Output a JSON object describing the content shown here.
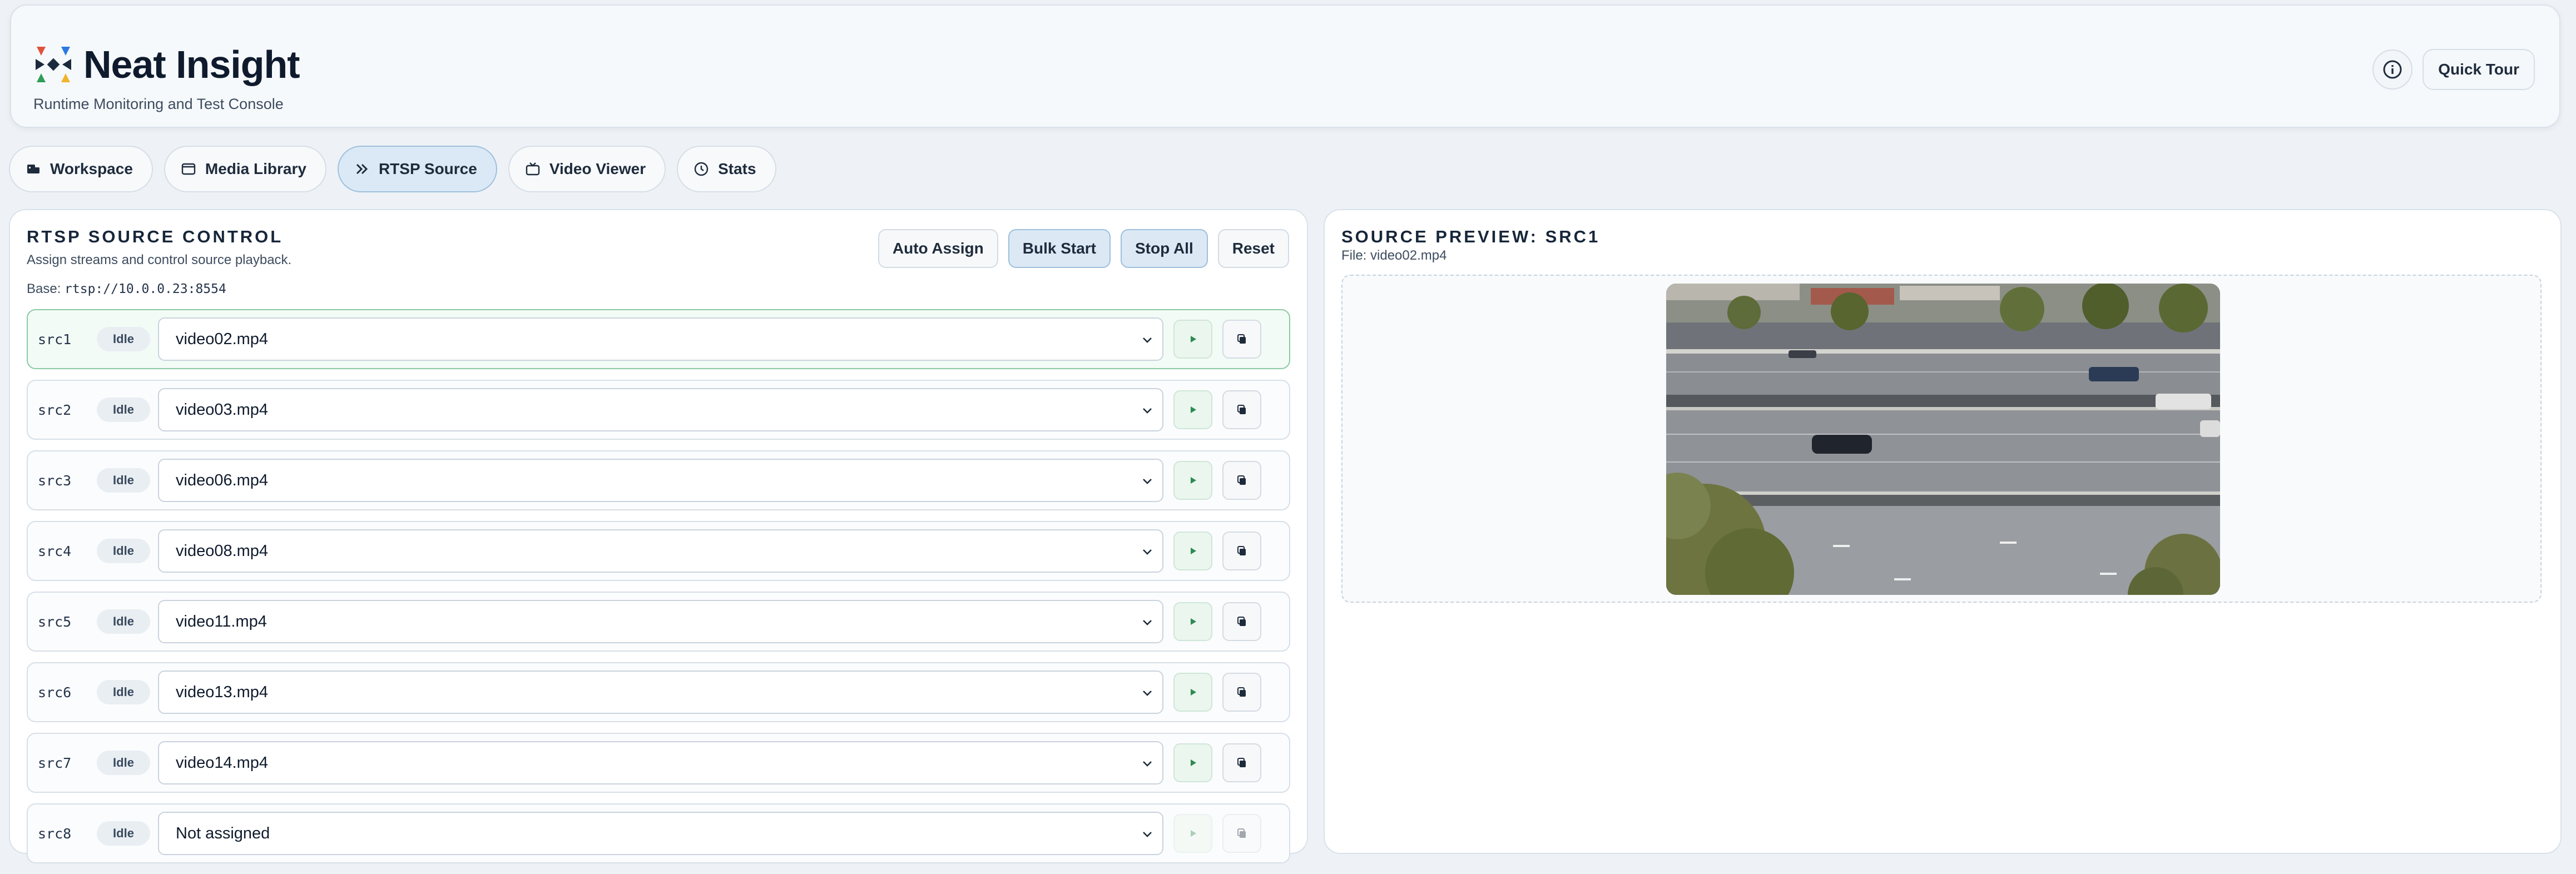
{
  "app": {
    "title": "Neat Insight",
    "subtitle": "Runtime Monitoring and Test Console",
    "logo_icon": "pinwheel-logo-icon",
    "quick_tour_label": "Quick Tour",
    "info_icon": "info-icon"
  },
  "tabs": [
    {
      "label": "Workspace",
      "icon": "workspace-icon",
      "active": false
    },
    {
      "label": "Media Library",
      "icon": "folder-icon",
      "active": false
    },
    {
      "label": "RTSP Source",
      "icon": "double-chevron-icon",
      "active": true
    },
    {
      "label": "Video Viewer",
      "icon": "tv-icon",
      "active": false
    },
    {
      "label": "Stats",
      "icon": "clock-icon",
      "active": false
    }
  ],
  "rtsp": {
    "title": "RTSP SOURCE CONTROL",
    "subtitle": "Assign streams and control source playback.",
    "base_label": "Base:",
    "base_url": "rtsp://10.0.0.23:8554",
    "actions": {
      "auto_assign": "Auto Assign",
      "bulk_start": "Bulk Start",
      "stop_all": "Stop All",
      "reset": "Reset"
    },
    "sources": [
      {
        "id": "src1",
        "status": "Idle",
        "file": "video02.mp4",
        "selected": true
      },
      {
        "id": "src2",
        "status": "Idle",
        "file": "video03.mp4"
      },
      {
        "id": "src3",
        "status": "Idle",
        "file": "video06.mp4"
      },
      {
        "id": "src4",
        "status": "Idle",
        "file": "video08.mp4"
      },
      {
        "id": "src5",
        "status": "Idle",
        "file": "video11.mp4"
      },
      {
        "id": "src6",
        "status": "Idle",
        "file": "video13.mp4"
      },
      {
        "id": "src7",
        "status": "Idle",
        "file": "video14.mp4"
      },
      {
        "id": "src8",
        "status": "Idle",
        "file": "Not assigned",
        "disabled": true
      }
    ]
  },
  "preview": {
    "title": "SOURCE PREVIEW: SRC1",
    "file": "File: video02.mp4"
  },
  "colors": {
    "accent_active_tab": "#dbe9f6",
    "selected_row_border": "#8ccaa6",
    "play_green": "#2f8a53"
  }
}
